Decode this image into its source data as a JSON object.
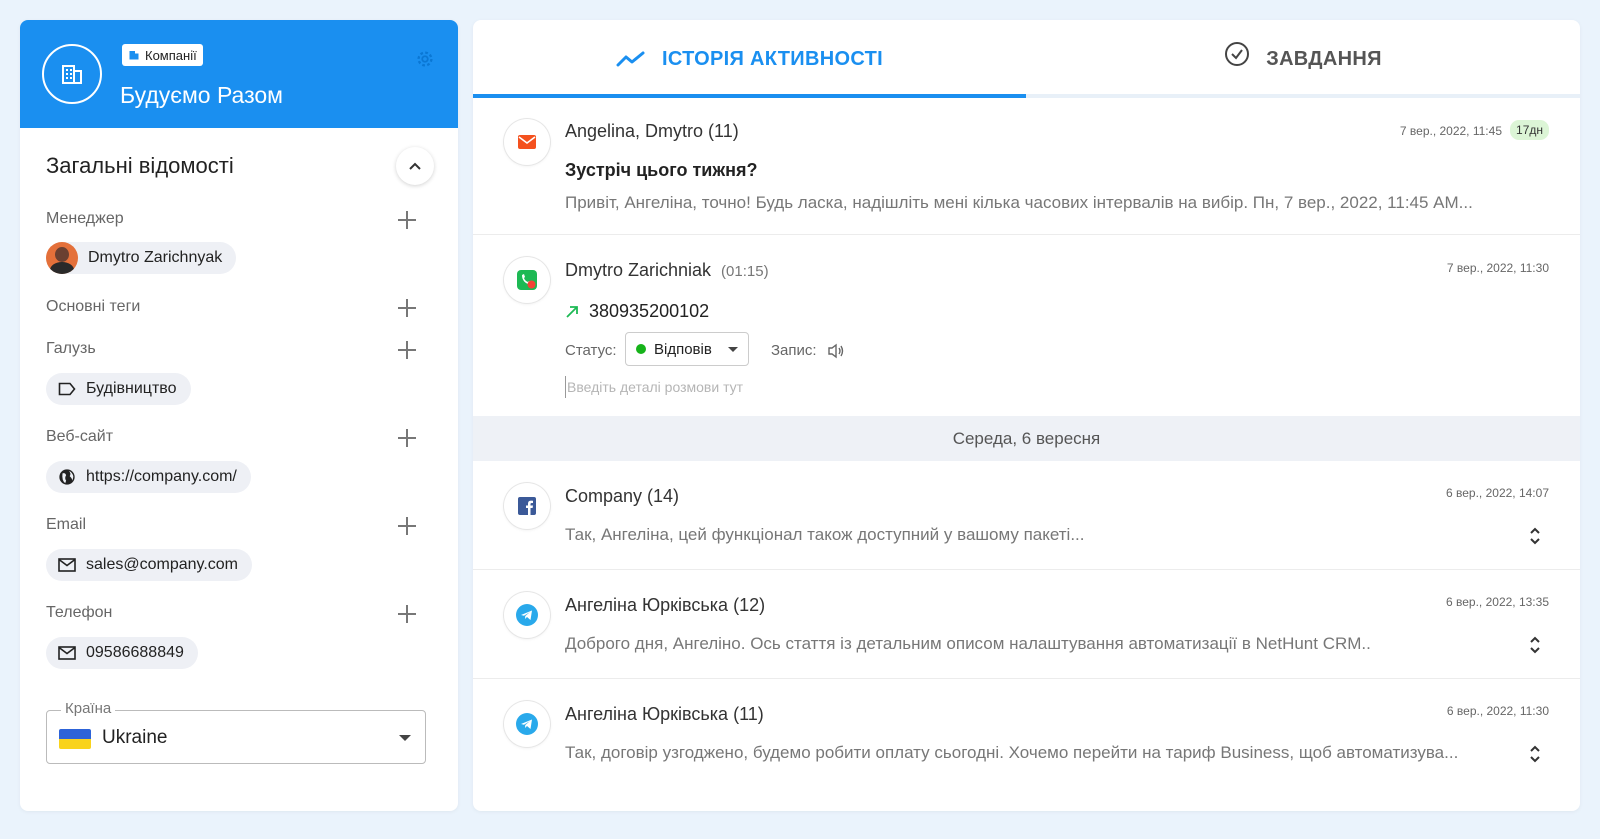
{
  "company": {
    "badge_label": "Компанії",
    "name": "Будуємо Разом"
  },
  "info": {
    "section_title": "Загальні відомості",
    "manager_label": "Менеджер",
    "manager_name": "Dmytro Zarichnyak",
    "tags_label": "Основні теги",
    "industry_label": "Галузь",
    "industry_value": "Будівництво",
    "website_label": "Веб-сайт",
    "website_value": "https://company.com/",
    "email_label": "Email",
    "email_value": "sales@company.com",
    "phone_label": "Телефон",
    "phone_value": "09586688849",
    "country_label": "Країна",
    "country_value": "Ukraine"
  },
  "tabs": {
    "activity": "ІСТОРІЯ АКТИВНОСТІ",
    "tasks": "ЗАВДАННЯ"
  },
  "feed": {
    "email_item": {
      "icon": "mail-icon",
      "title": "Angelina, Dmytro (11)",
      "time": "7 вер., 2022, 11:45",
      "days": "17дн",
      "subject": "Зустріч цього тижня?",
      "preview": "Привіт, Ангеліна, точно! Будь ласка, надішліть мені кілька часових інтервалів на вибір. Пн, 7 вер., 2022, 11:45 AM..."
    },
    "call_item": {
      "icon": "call-icon",
      "title": "Dmytro Zarichniak",
      "duration": "(01:15)",
      "time": "7 вер., 2022, 11:30",
      "phone": "380935200102",
      "status_label": "Статус:",
      "status_value": "Відповів",
      "record_label": "Запис:",
      "details_placeholder": "Введіть деталі розмови тут"
    },
    "day_separator": "Середа, 6 вересня",
    "facebook_item": {
      "icon": "facebook-icon",
      "title": "Company (14)",
      "time": "6 вер., 2022, 14:07",
      "preview": "Так, Ангеліна, цей функціонал також доступний у вашому пакеті..."
    },
    "telegram_item_1": {
      "icon": "telegram-icon",
      "title": "Ангеліна Юрківська (12)",
      "time": "6 вер., 2022, 13:35",
      "preview": "Доброго дня, Ангеліно. Ось стаття із детальним описом налаштування автоматизації в NetHunt CRM.."
    },
    "telegram_item_2": {
      "icon": "telegram-icon",
      "title": "Ангеліна Юрківська (11)",
      "time": "6 вер., 2022, 11:30",
      "preview": "Так, договір узгоджено, будемо робити оплату сьогодні. Хочемо перейти на тариф Business, щоб автоматизува..."
    }
  },
  "colors": {
    "primary": "#1a8ff0",
    "mail": "#f4511e",
    "call": "#1db954",
    "facebook": "#3b5998",
    "telegram": "#29a9eb",
    "status_green": "#16b31a",
    "days_badge": "#dcf5d6"
  }
}
